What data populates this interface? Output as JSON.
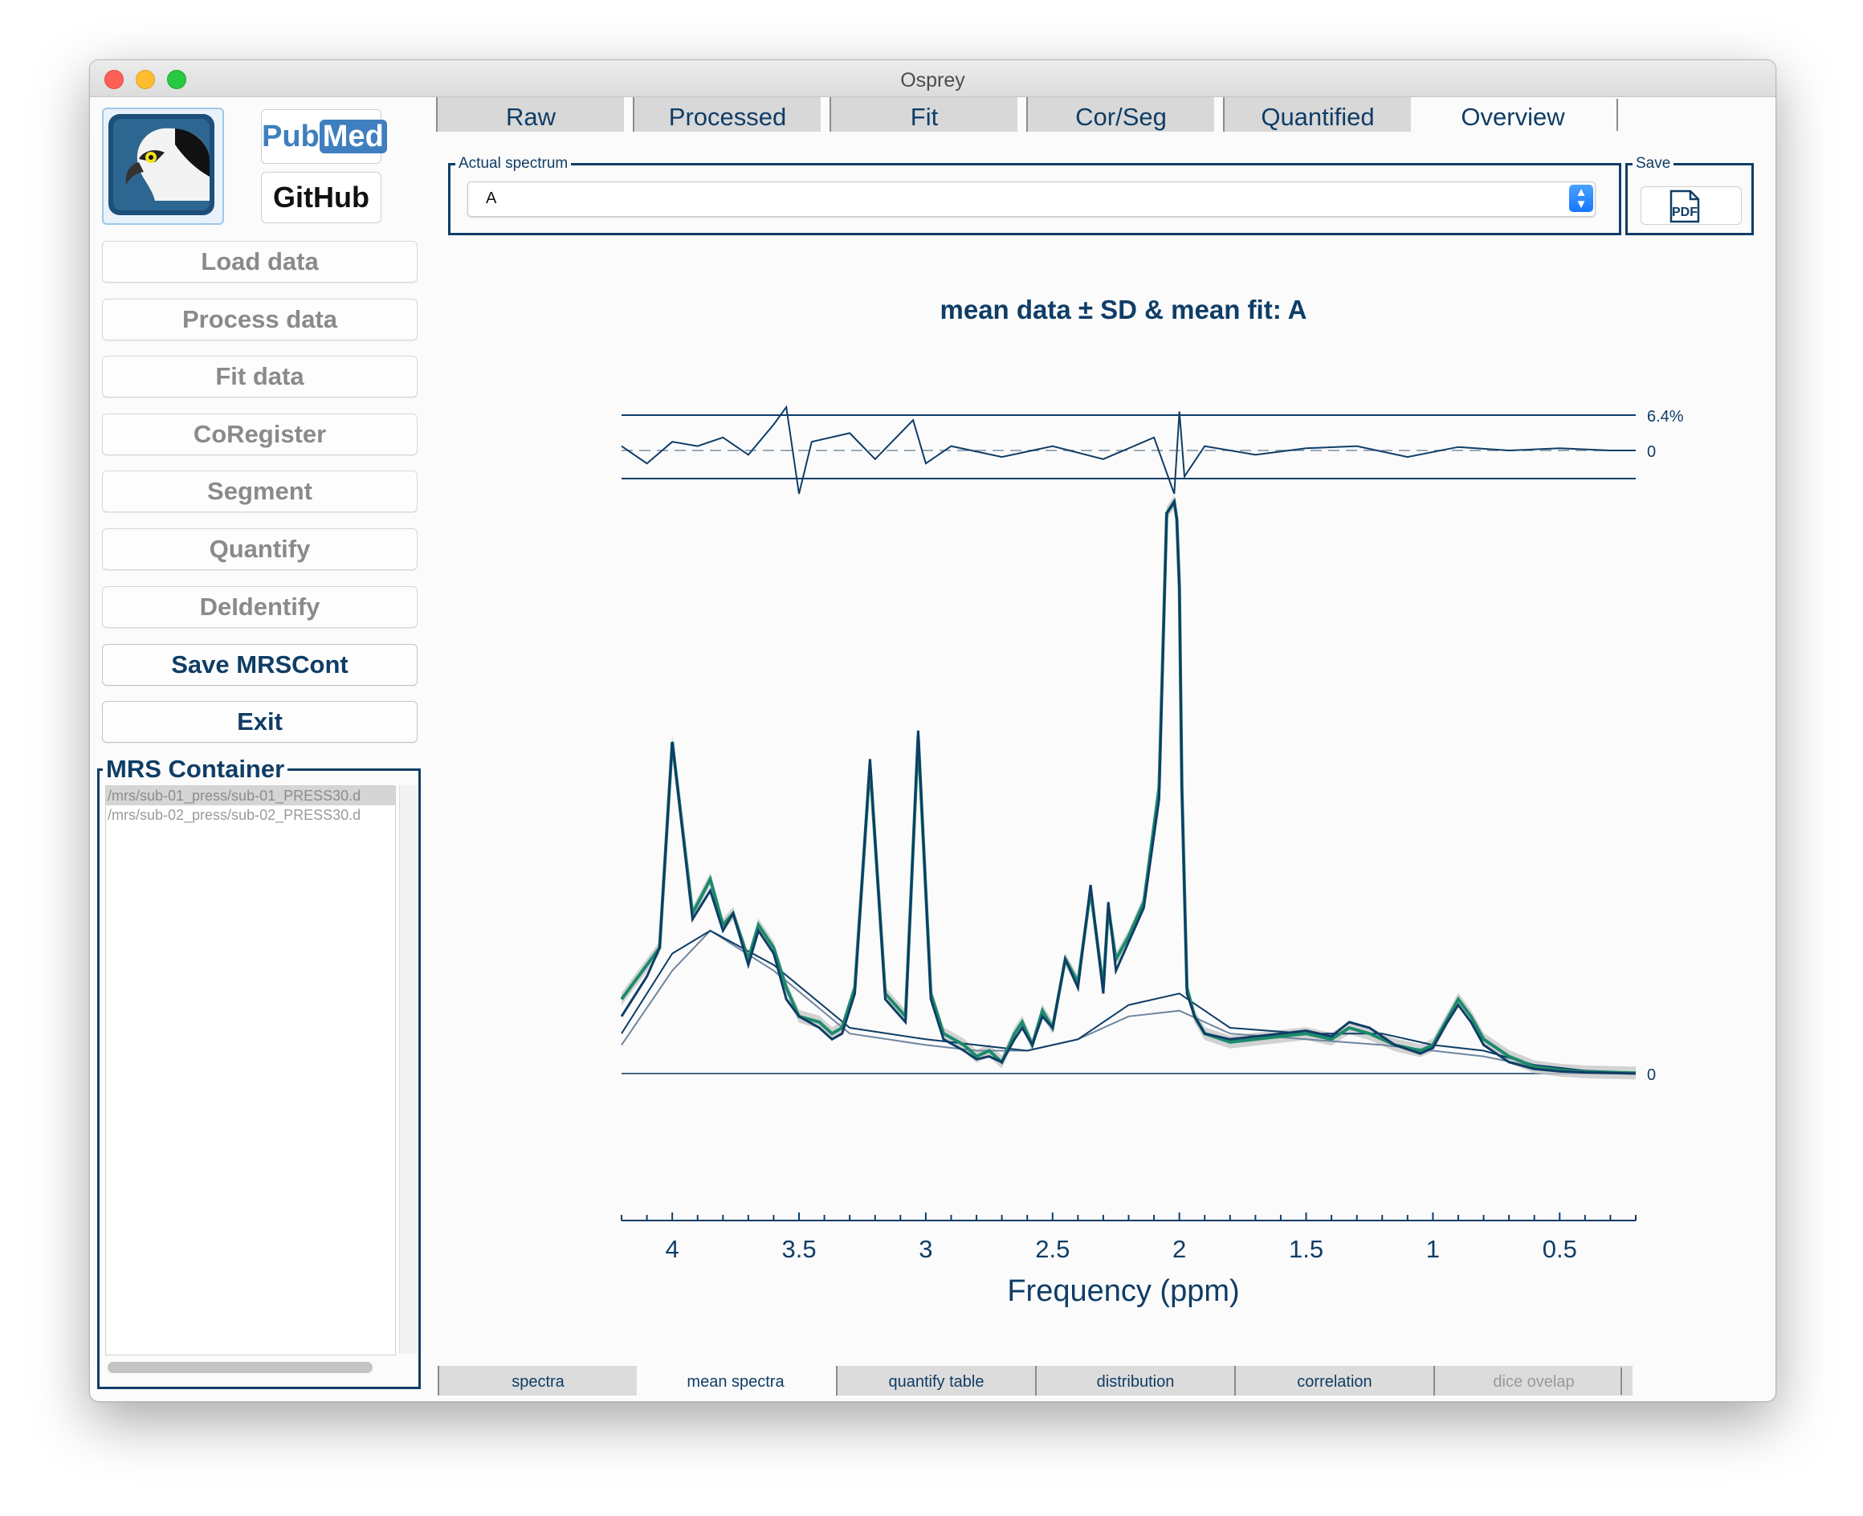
{
  "window": {
    "title": "Osprey"
  },
  "logos": {
    "pubmed_pub": "Pub",
    "pubmed_med": "Med",
    "github": "GitHub"
  },
  "sidebar": {
    "buttons": [
      {
        "label": "Load data",
        "active": false
      },
      {
        "label": "Process data",
        "active": false
      },
      {
        "label": "Fit data",
        "active": false
      },
      {
        "label": "CoRegister",
        "active": false
      },
      {
        "label": "Segment",
        "active": false
      },
      {
        "label": "Quantify",
        "active": false
      },
      {
        "label": "DeIdentify",
        "active": false
      },
      {
        "label": "Save MRSCont",
        "active": true
      },
      {
        "label": "Exit",
        "active": true
      }
    ]
  },
  "mrs_container": {
    "title": "MRS Container",
    "files": [
      "/mrs/sub-01_press/sub-01_PRESS30.d",
      "/mrs/sub-02_press/sub-02_PRESS30.d"
    ]
  },
  "top_tabs": [
    "Raw",
    "Processed",
    "Fit",
    "Cor/Seg",
    "Quantified",
    "Overview"
  ],
  "top_tab_selected": "Overview",
  "spectrum_selector": {
    "legend": "Actual spectrum",
    "value": "A"
  },
  "save_panel": {
    "legend": "Save",
    "button": "PDF"
  },
  "bottom_tabs": [
    "spectra",
    "mean spectra",
    "quantify table",
    "distribution",
    "correlation",
    "dice ovelap"
  ],
  "bottom_tab_selected": "mean spectra",
  "bottom_tab_disabled": "dice ovelap",
  "colors": {
    "primary": "#0f3d66",
    "fit": "#1b8a6b",
    "sd_band": "#c8c8c8",
    "baseline": "#4a6785"
  },
  "chart_data": {
    "type": "line",
    "title": "mean data ± SD & mean fit: A",
    "xlabel": "Frequency (ppm)",
    "xlim": [
      4.2,
      0.2
    ],
    "x_reversed": true,
    "xticks": [
      "4",
      "3.5",
      "3",
      "2.5",
      "2",
      "1.5",
      "1",
      "0.5"
    ],
    "xtick_values": [
      4,
      3.5,
      3,
      2.5,
      2,
      1.5,
      1,
      0.5
    ],
    "residual_labels": {
      "max": "6.4%",
      "zero": "0"
    },
    "zero_label": "0",
    "series": [
      {
        "name": "mean data",
        "x": [
          4.2,
          4.1,
          4.05,
          4.0,
          3.92,
          3.85,
          3.8,
          3.76,
          3.7,
          3.66,
          3.6,
          3.55,
          3.5,
          3.42,
          3.37,
          3.33,
          3.28,
          3.22,
          3.16,
          3.12,
          3.08,
          3.03,
          2.98,
          2.93,
          2.85,
          2.8,
          2.75,
          2.7,
          2.65,
          2.62,
          2.58,
          2.54,
          2.5,
          2.45,
          2.4,
          2.35,
          2.3,
          2.28,
          2.25,
          2.2,
          2.14,
          2.08,
          2.05,
          2.02,
          2.01,
          2.0,
          1.99,
          1.97,
          1.94,
          1.9,
          1.8,
          1.7,
          1.6,
          1.5,
          1.4,
          1.33,
          1.25,
          1.15,
          1.05,
          1.0,
          0.95,
          0.9,
          0.85,
          0.8,
          0.7,
          0.6,
          0.5,
          0.4,
          0.3,
          0.2
        ],
        "y": [
          0.13,
          0.19,
          0.22,
          0.58,
          0.28,
          0.34,
          0.26,
          0.28,
          0.2,
          0.26,
          0.22,
          0.15,
          0.1,
          0.09,
          0.07,
          0.08,
          0.15,
          0.54,
          0.14,
          0.12,
          0.1,
          0.59,
          0.14,
          0.07,
          0.05,
          0.03,
          0.04,
          0.02,
          0.07,
          0.09,
          0.05,
          0.11,
          0.08,
          0.2,
          0.16,
          0.32,
          0.15,
          0.29,
          0.2,
          0.24,
          0.3,
          0.5,
          0.98,
          1.0,
          0.97,
          0.85,
          0.5,
          0.15,
          0.1,
          0.07,
          0.055,
          0.06,
          0.065,
          0.07,
          0.06,
          0.08,
          0.07,
          0.05,
          0.04,
          0.05,
          0.09,
          0.13,
          0.1,
          0.06,
          0.03,
          0.012,
          0.006,
          0.003,
          0.002,
          0.001
        ]
      },
      {
        "name": "mean fit",
        "x": [
          4.2,
          4.1,
          4.05,
          4.0,
          3.92,
          3.85,
          3.8,
          3.76,
          3.7,
          3.66,
          3.6,
          3.55,
          3.5,
          3.42,
          3.37,
          3.33,
          3.28,
          3.22,
          3.16,
          3.12,
          3.08,
          3.03,
          2.98,
          2.93,
          2.85,
          2.8,
          2.75,
          2.7,
          2.65,
          2.62,
          2.58,
          2.54,
          2.5,
          2.45,
          2.4,
          2.35,
          2.3,
          2.28,
          2.25,
          2.2,
          2.14,
          2.08,
          2.05,
          2.02,
          2.01,
          2.0,
          1.99,
          1.97,
          1.94,
          1.9,
          1.8,
          1.7,
          1.6,
          1.5,
          1.4,
          1.33,
          1.25,
          1.15,
          1.05,
          1.0,
          0.95,
          0.9,
          0.85,
          0.8,
          0.7,
          0.6,
          0.5,
          0.4,
          0.3,
          0.2
        ],
        "y": [
          0.1,
          0.17,
          0.22,
          0.58,
          0.27,
          0.32,
          0.25,
          0.28,
          0.19,
          0.25,
          0.21,
          0.13,
          0.1,
          0.08,
          0.06,
          0.07,
          0.14,
          0.55,
          0.13,
          0.11,
          0.09,
          0.6,
          0.13,
          0.06,
          0.04,
          0.025,
          0.03,
          0.02,
          0.06,
          0.08,
          0.05,
          0.1,
          0.08,
          0.2,
          0.15,
          0.33,
          0.14,
          0.3,
          0.18,
          0.23,
          0.29,
          0.48,
          0.98,
          1.0,
          0.97,
          0.85,
          0.5,
          0.14,
          0.1,
          0.07,
          0.06,
          0.065,
          0.07,
          0.075,
          0.065,
          0.09,
          0.08,
          0.05,
          0.035,
          0.045,
          0.085,
          0.12,
          0.09,
          0.05,
          0.02,
          0.008,
          0.004,
          0.002,
          0.001,
          0.0
        ]
      },
      {
        "name": "baseline",
        "x": [
          4.2,
          4.0,
          3.85,
          3.6,
          3.3,
          3.0,
          2.8,
          2.6,
          2.4,
          2.2,
          2.0,
          1.8,
          1.5,
          1.2,
          1.0,
          0.8,
          0.6,
          0.4,
          0.2
        ],
        "y": [
          0.07,
          0.21,
          0.25,
          0.19,
          0.08,
          0.06,
          0.05,
          0.04,
          0.06,
          0.12,
          0.14,
          0.08,
          0.07,
          0.07,
          0.05,
          0.04,
          0.015,
          0.005,
          0.002
        ]
      },
      {
        "name": "macromolecules",
        "x": [
          4.2,
          4.0,
          3.85,
          3.6,
          3.3,
          3.0,
          2.8,
          2.6,
          2.4,
          2.2,
          2.0,
          1.8,
          1.5,
          1.2,
          1.0,
          0.8,
          0.6,
          0.4,
          0.2
        ],
        "y": [
          0.05,
          0.18,
          0.25,
          0.18,
          0.07,
          0.05,
          0.04,
          0.04,
          0.06,
          0.1,
          0.11,
          0.07,
          0.06,
          0.05,
          0.04,
          0.03,
          0.012,
          0.004,
          0.001
        ]
      }
    ],
    "residual": {
      "x": [
        4.2,
        4.1,
        4.0,
        3.9,
        3.8,
        3.7,
        3.6,
        3.55,
        3.5,
        3.45,
        3.3,
        3.2,
        3.05,
        3.0,
        2.9,
        2.7,
        2.5,
        2.3,
        2.1,
        2.02,
        2.0,
        1.98,
        1.9,
        1.7,
        1.5,
        1.3,
        1.1,
        0.9,
        0.7,
        0.5,
        0.3,
        0.2
      ],
      "y": [
        0.1,
        -0.3,
        0.2,
        0.1,
        0.3,
        -0.1,
        0.6,
        1.0,
        -1.0,
        0.2,
        0.4,
        -0.2,
        0.7,
        -0.3,
        0.1,
        -0.15,
        0.1,
        -0.2,
        0.3,
        -1.0,
        0.9,
        -0.6,
        0.1,
        -0.1,
        0.05,
        0.1,
        -0.15,
        0.08,
        0.0,
        0.05,
        0.0,
        0.0
      ]
    }
  }
}
